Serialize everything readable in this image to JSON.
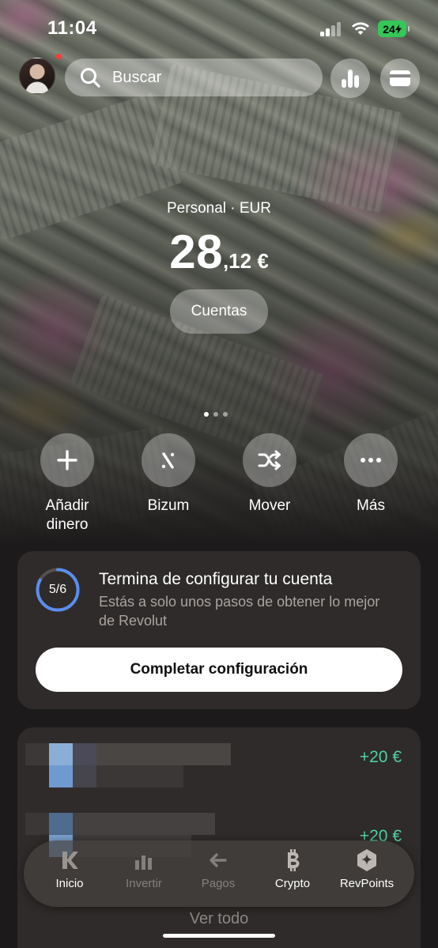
{
  "status_bar": {
    "time": "11:04",
    "battery": "24"
  },
  "header": {
    "search_placeholder": "Buscar",
    "stats_icon": "bar-chart-icon",
    "cards_icon": "card-icon"
  },
  "balance": {
    "account_label": "Personal · EUR",
    "amount_int": "28",
    "amount_dec": ",12 €",
    "accounts_button": "Cuentas",
    "page_indicator": {
      "pages": 3,
      "active": 1
    }
  },
  "actions": [
    {
      "label": "Añadir dinero",
      "icon": "plus-icon"
    },
    {
      "label": "Bizum",
      "icon": "bizum-icon"
    },
    {
      "label": "Mover",
      "icon": "shuffle-icon"
    },
    {
      "label": "Más",
      "icon": "more-icon"
    }
  ],
  "setup_card": {
    "progress_text": "5/6",
    "progress_fraction": 0.83,
    "title": "Termina de configurar tu cuenta",
    "subtitle": "Estás a solo unos pasos de obtener lo mejor de Revolut",
    "button": "Completar configuración"
  },
  "transactions": [
    {
      "amount": "+20 €"
    },
    {
      "amount": "+20 €"
    }
  ],
  "see_all": "Ver todo",
  "tabs": [
    {
      "label": "Inicio",
      "icon": "home-icon"
    },
    {
      "label": "Invertir",
      "icon": "invest-icon"
    },
    {
      "label": "Pagos",
      "icon": "payments-icon"
    },
    {
      "label": "Crypto",
      "icon": "bitcoin-icon"
    },
    {
      "label": "RevPoints",
      "icon": "revpoints-icon"
    }
  ],
  "colors": {
    "accent_green": "#4fd1a5",
    "progress_blue": "#5b8def",
    "card_bg": "#2e2b2a"
  }
}
